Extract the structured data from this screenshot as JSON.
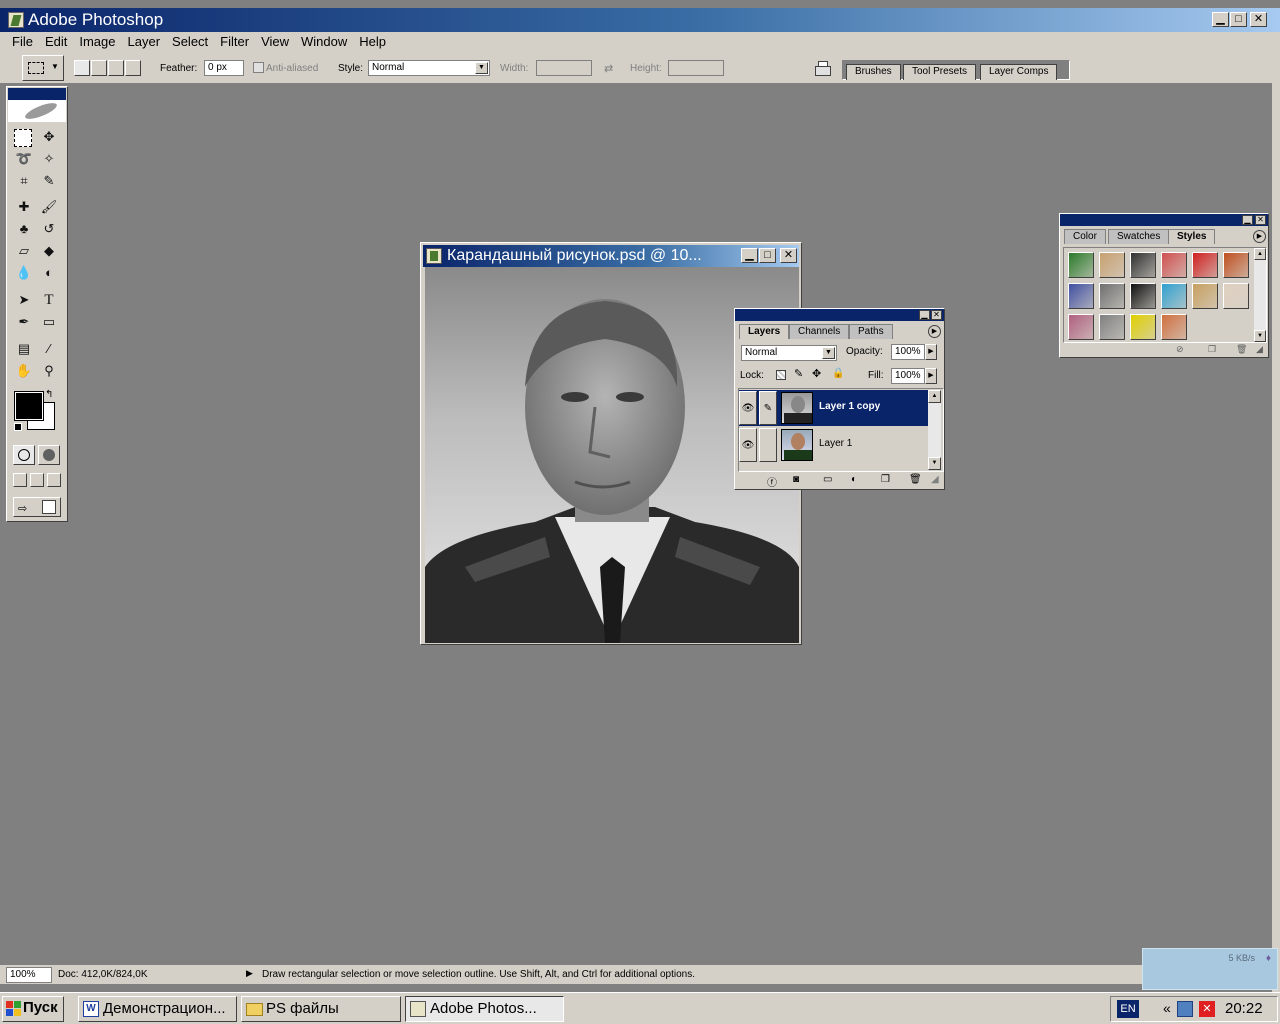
{
  "app": {
    "title": "Adobe Photoshop"
  },
  "window_controls": {
    "minimize": "▁",
    "maximize": "□",
    "close": "✕"
  },
  "menu": [
    "File",
    "Edit",
    "Image",
    "Layer",
    "Select",
    "Filter",
    "View",
    "Window",
    "Help"
  ],
  "options": {
    "feather_label": "Feather:",
    "feather_value": "0 px",
    "antialiased_label": "Anti-aliased",
    "style_label": "Style:",
    "style_value": "Normal",
    "width_label": "Width:",
    "height_label": "Height:"
  },
  "palette_well": {
    "tabs": [
      "Brushes",
      "Tool Presets",
      "Layer Comps"
    ]
  },
  "document": {
    "title": "Карандашный рисунок.psd @ 10..."
  },
  "layers_panel": {
    "tabs": [
      "Layers",
      "Channels",
      "Paths"
    ],
    "blend_mode": "Normal",
    "opacity_label": "Opacity:",
    "opacity_value": "100%",
    "lock_label": "Lock:",
    "fill_label": "Fill:",
    "fill_value": "100%",
    "layers": [
      {
        "name": "Layer 1 copy",
        "selected": true
      },
      {
        "name": "Layer 1",
        "selected": false
      }
    ]
  },
  "styles_panel": {
    "tabs": [
      "Color",
      "Swatches",
      "Styles"
    ],
    "swatch_colors": [
      "#2a7a2a",
      "#c8a070",
      "#303030",
      "#d05050",
      "#d02020",
      "#c05020",
      "#4050a0",
      "#707070",
      "#101010",
      "#30a0d0",
      "#c8a060",
      "#e0d0c0",
      "#b06080",
      "#808080",
      "#e0d000",
      "#d07040"
    ]
  },
  "status": {
    "zoom": "100%",
    "doc": "Doc: 412,0K/824,0K",
    "hint": "Draw rectangular selection or move selection outline.  Use Shift, Alt, and Ctrl for additional options."
  },
  "network": {
    "speed": "5 KB/s"
  },
  "taskbar": {
    "start": "Пуск",
    "tasks": [
      "Демонстрацион...",
      "PS файлы",
      "Adobe Photos..."
    ],
    "lang": "EN",
    "clock": "20:22"
  }
}
